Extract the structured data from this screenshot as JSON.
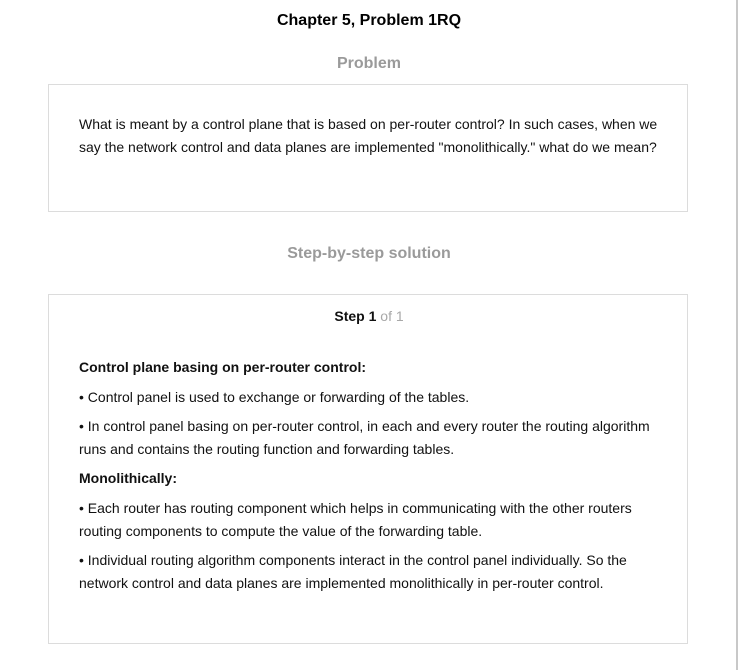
{
  "chapter_title": "Chapter 5, Problem 1RQ",
  "problem": {
    "heading": "Problem",
    "text": "What is meant by a control plane that is based on per-router control? In such cases, when we say the network control and data planes are implemented \"monolithically.\" what do we mean?"
  },
  "solution": {
    "heading": "Step-by-step solution",
    "step_word": "Step",
    "step_number": "1",
    "step_of": "of 1",
    "sections": [
      {
        "heading": "Control plane basing on per-router control:",
        "bullets": [
          "• Control panel is used to exchange or forwarding of the tables.",
          "• In control panel basing on per-router control, in each and every router the routing algorithm runs and contains the routing function and forwarding tables."
        ]
      },
      {
        "heading": "Monolithically:",
        "bullets": [
          "• Each router has routing component which helps in communicating with the other routers routing components to compute the value of the forwarding table.",
          "• Individual routing algorithm components interact in the control panel individually. So the network control and data planes are implemented monolithically in per-router control."
        ]
      }
    ]
  }
}
